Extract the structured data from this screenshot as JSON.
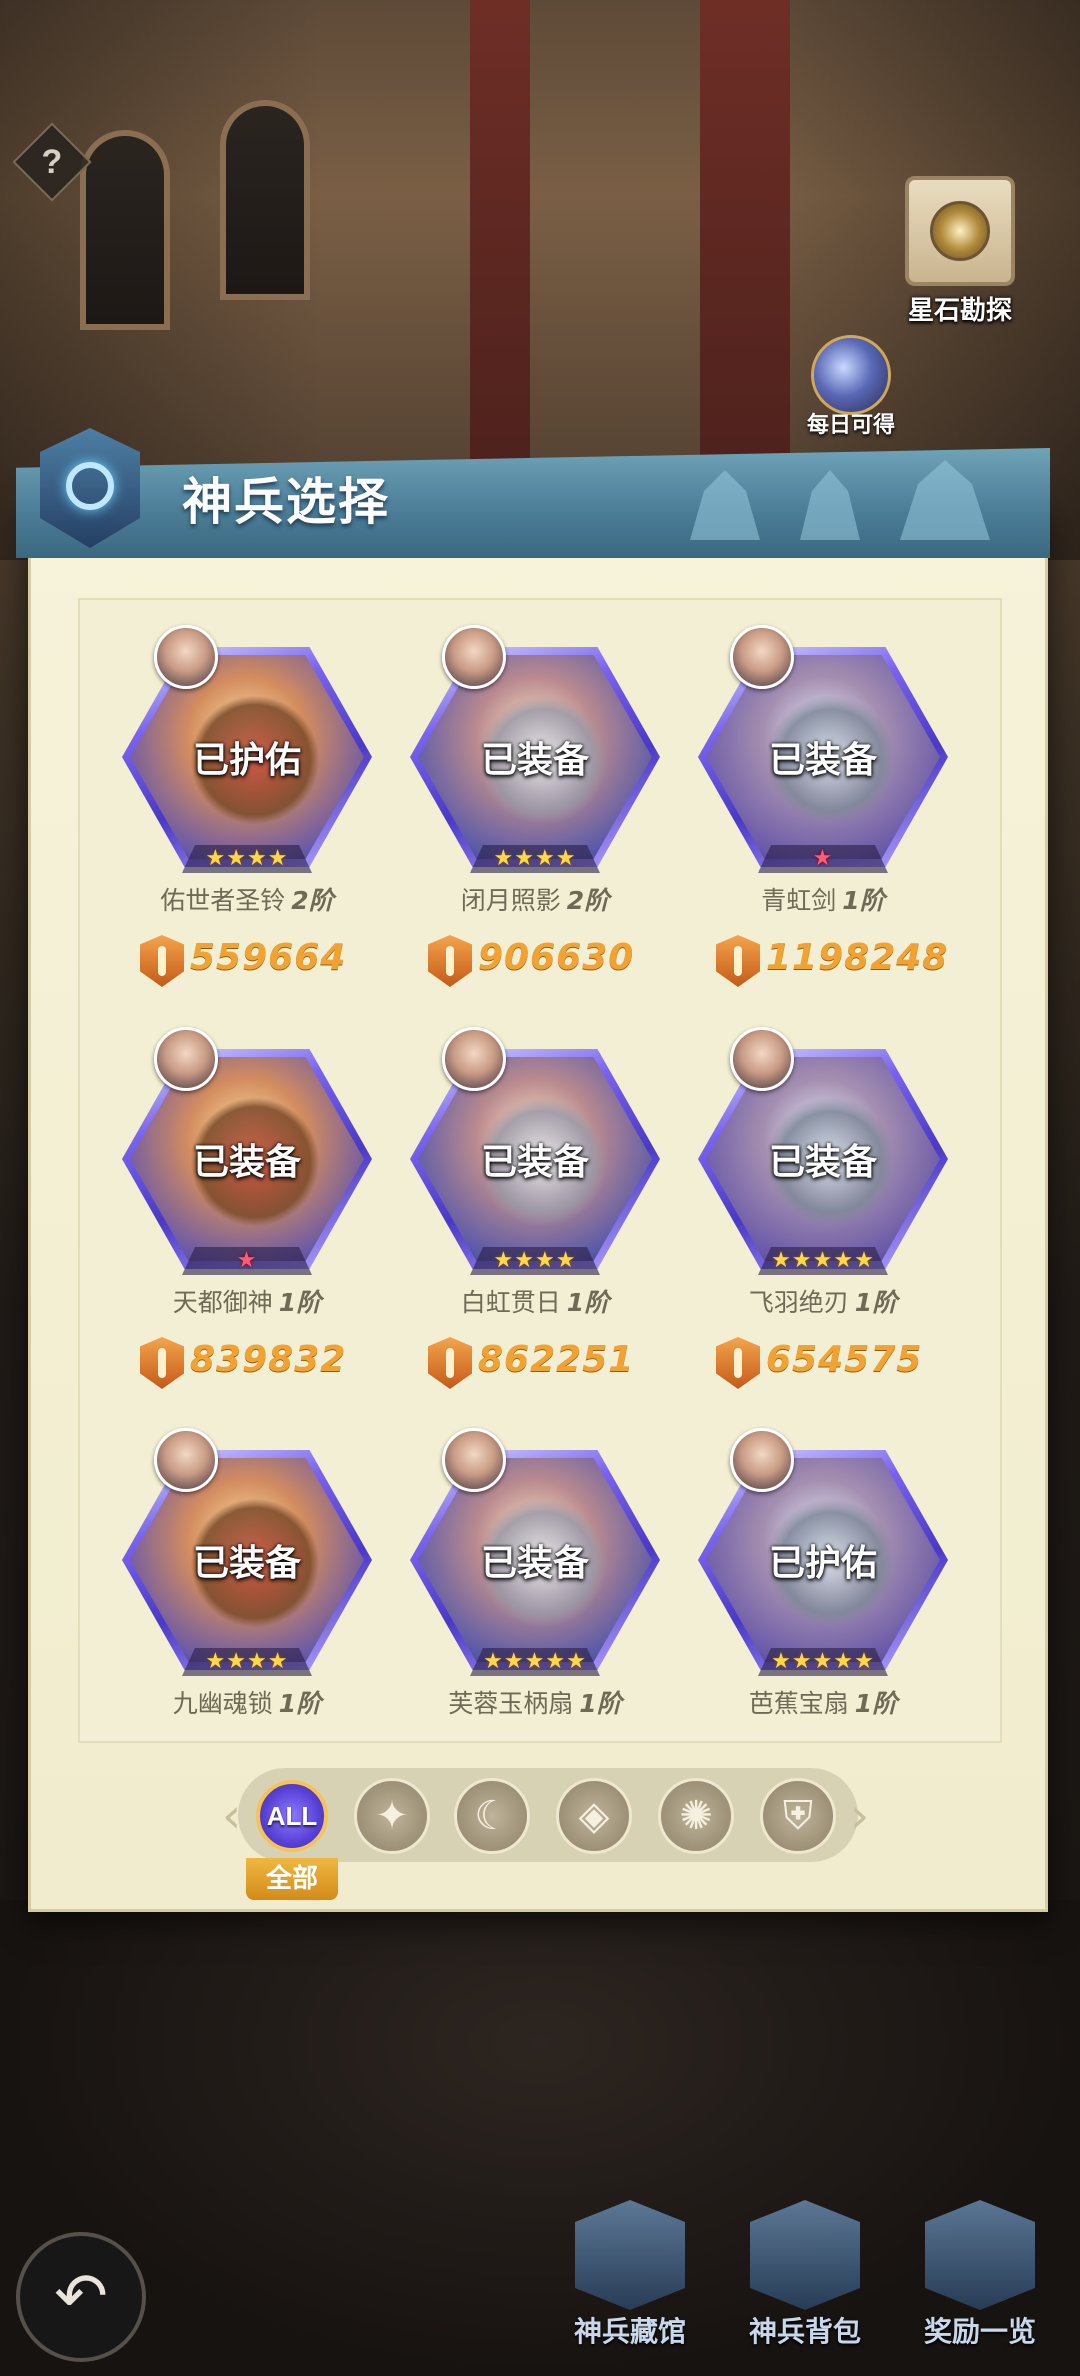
{
  "help": {
    "label": "?"
  },
  "shortcuts": {
    "explore_label": "星石勘探",
    "daily_label": "每日可得"
  },
  "panel": {
    "title": "神兵选择"
  },
  "weapons": [
    {
      "name": "佑世者圣铃",
      "tier": "2阶",
      "status": "已护佑",
      "power": "559664",
      "stars": 4,
      "star_color": "gold"
    },
    {
      "name": "闭月照影",
      "tier": "2阶",
      "status": "已装备",
      "power": "906630",
      "stars": 4,
      "star_color": "gold"
    },
    {
      "name": "青虹剑",
      "tier": "1阶",
      "status": "已装备",
      "power": "1198248",
      "stars": 1,
      "star_color": "red"
    },
    {
      "name": "天都御神",
      "tier": "1阶",
      "status": "已装备",
      "power": "839832",
      "stars": 1,
      "star_color": "red"
    },
    {
      "name": "白虹贯日",
      "tier": "1阶",
      "status": "已装备",
      "power": "862251",
      "stars": 4,
      "star_color": "gold"
    },
    {
      "name": "飞羽绝刃",
      "tier": "1阶",
      "status": "已装备",
      "power": "654575",
      "stars": 5,
      "star_color": "gold"
    },
    {
      "name": "九幽魂锁",
      "tier": "1阶",
      "status": "已装备",
      "power": "",
      "stars": 4,
      "star_color": "gold"
    },
    {
      "name": "芙蓉玉柄扇",
      "tier": "1阶",
      "status": "已装备",
      "power": "",
      "stars": 5,
      "star_color": "gold"
    },
    {
      "name": "芭蕉宝扇",
      "tier": "1阶",
      "status": "已护佑",
      "power": "",
      "stars": 5,
      "star_color": "gold"
    }
  ],
  "filter": {
    "all_icon_text": "ALL",
    "all_label": "全部",
    "icons": [
      "crown-filter-icon",
      "moon-filter-icon",
      "diamond-filter-icon",
      "shuriken-filter-icon",
      "shield-filter-icon"
    ]
  },
  "bottom_nav": {
    "back_label": "↶",
    "items": [
      "神兵藏馆",
      "神兵背包",
      "奖励一览"
    ]
  },
  "colors": {
    "panel_bg": "#f6f3da",
    "header_blue": "#4d7f99",
    "power_orange": "#f0a233",
    "hex_purple": "#4a39c6"
  }
}
